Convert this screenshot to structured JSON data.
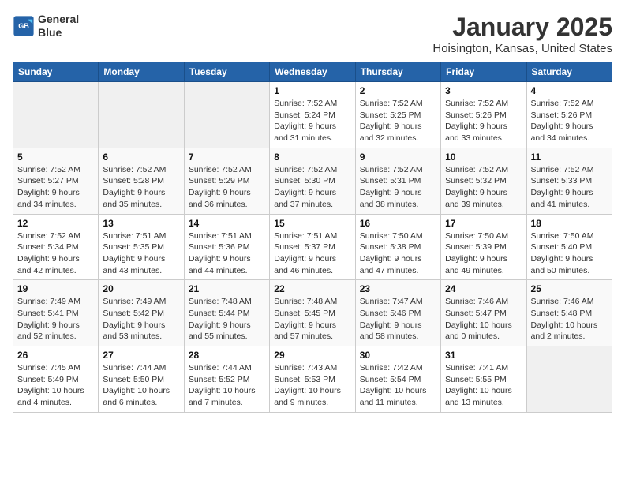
{
  "header": {
    "logo_line1": "General",
    "logo_line2": "Blue",
    "title": "January 2025",
    "subtitle": "Hoisington, Kansas, United States"
  },
  "weekdays": [
    "Sunday",
    "Monday",
    "Tuesday",
    "Wednesday",
    "Thursday",
    "Friday",
    "Saturday"
  ],
  "weeks": [
    [
      {
        "day": "",
        "info": ""
      },
      {
        "day": "",
        "info": ""
      },
      {
        "day": "",
        "info": ""
      },
      {
        "day": "1",
        "info": "Sunrise: 7:52 AM\nSunset: 5:24 PM\nDaylight: 9 hours\nand 31 minutes."
      },
      {
        "day": "2",
        "info": "Sunrise: 7:52 AM\nSunset: 5:25 PM\nDaylight: 9 hours\nand 32 minutes."
      },
      {
        "day": "3",
        "info": "Sunrise: 7:52 AM\nSunset: 5:26 PM\nDaylight: 9 hours\nand 33 minutes."
      },
      {
        "day": "4",
        "info": "Sunrise: 7:52 AM\nSunset: 5:26 PM\nDaylight: 9 hours\nand 34 minutes."
      }
    ],
    [
      {
        "day": "5",
        "info": "Sunrise: 7:52 AM\nSunset: 5:27 PM\nDaylight: 9 hours\nand 34 minutes."
      },
      {
        "day": "6",
        "info": "Sunrise: 7:52 AM\nSunset: 5:28 PM\nDaylight: 9 hours\nand 35 minutes."
      },
      {
        "day": "7",
        "info": "Sunrise: 7:52 AM\nSunset: 5:29 PM\nDaylight: 9 hours\nand 36 minutes."
      },
      {
        "day": "8",
        "info": "Sunrise: 7:52 AM\nSunset: 5:30 PM\nDaylight: 9 hours\nand 37 minutes."
      },
      {
        "day": "9",
        "info": "Sunrise: 7:52 AM\nSunset: 5:31 PM\nDaylight: 9 hours\nand 38 minutes."
      },
      {
        "day": "10",
        "info": "Sunrise: 7:52 AM\nSunset: 5:32 PM\nDaylight: 9 hours\nand 39 minutes."
      },
      {
        "day": "11",
        "info": "Sunrise: 7:52 AM\nSunset: 5:33 PM\nDaylight: 9 hours\nand 41 minutes."
      }
    ],
    [
      {
        "day": "12",
        "info": "Sunrise: 7:52 AM\nSunset: 5:34 PM\nDaylight: 9 hours\nand 42 minutes."
      },
      {
        "day": "13",
        "info": "Sunrise: 7:51 AM\nSunset: 5:35 PM\nDaylight: 9 hours\nand 43 minutes."
      },
      {
        "day": "14",
        "info": "Sunrise: 7:51 AM\nSunset: 5:36 PM\nDaylight: 9 hours\nand 44 minutes."
      },
      {
        "day": "15",
        "info": "Sunrise: 7:51 AM\nSunset: 5:37 PM\nDaylight: 9 hours\nand 46 minutes."
      },
      {
        "day": "16",
        "info": "Sunrise: 7:50 AM\nSunset: 5:38 PM\nDaylight: 9 hours\nand 47 minutes."
      },
      {
        "day": "17",
        "info": "Sunrise: 7:50 AM\nSunset: 5:39 PM\nDaylight: 9 hours\nand 49 minutes."
      },
      {
        "day": "18",
        "info": "Sunrise: 7:50 AM\nSunset: 5:40 PM\nDaylight: 9 hours\nand 50 minutes."
      }
    ],
    [
      {
        "day": "19",
        "info": "Sunrise: 7:49 AM\nSunset: 5:41 PM\nDaylight: 9 hours\nand 52 minutes."
      },
      {
        "day": "20",
        "info": "Sunrise: 7:49 AM\nSunset: 5:42 PM\nDaylight: 9 hours\nand 53 minutes."
      },
      {
        "day": "21",
        "info": "Sunrise: 7:48 AM\nSunset: 5:44 PM\nDaylight: 9 hours\nand 55 minutes."
      },
      {
        "day": "22",
        "info": "Sunrise: 7:48 AM\nSunset: 5:45 PM\nDaylight: 9 hours\nand 57 minutes."
      },
      {
        "day": "23",
        "info": "Sunrise: 7:47 AM\nSunset: 5:46 PM\nDaylight: 9 hours\nand 58 minutes."
      },
      {
        "day": "24",
        "info": "Sunrise: 7:46 AM\nSunset: 5:47 PM\nDaylight: 10 hours\nand 0 minutes."
      },
      {
        "day": "25",
        "info": "Sunrise: 7:46 AM\nSunset: 5:48 PM\nDaylight: 10 hours\nand 2 minutes."
      }
    ],
    [
      {
        "day": "26",
        "info": "Sunrise: 7:45 AM\nSunset: 5:49 PM\nDaylight: 10 hours\nand 4 minutes."
      },
      {
        "day": "27",
        "info": "Sunrise: 7:44 AM\nSunset: 5:50 PM\nDaylight: 10 hours\nand 6 minutes."
      },
      {
        "day": "28",
        "info": "Sunrise: 7:44 AM\nSunset: 5:52 PM\nDaylight: 10 hours\nand 7 minutes."
      },
      {
        "day": "29",
        "info": "Sunrise: 7:43 AM\nSunset: 5:53 PM\nDaylight: 10 hours\nand 9 minutes."
      },
      {
        "day": "30",
        "info": "Sunrise: 7:42 AM\nSunset: 5:54 PM\nDaylight: 10 hours\nand 11 minutes."
      },
      {
        "day": "31",
        "info": "Sunrise: 7:41 AM\nSunset: 5:55 PM\nDaylight: 10 hours\nand 13 minutes."
      },
      {
        "day": "",
        "info": ""
      }
    ]
  ]
}
